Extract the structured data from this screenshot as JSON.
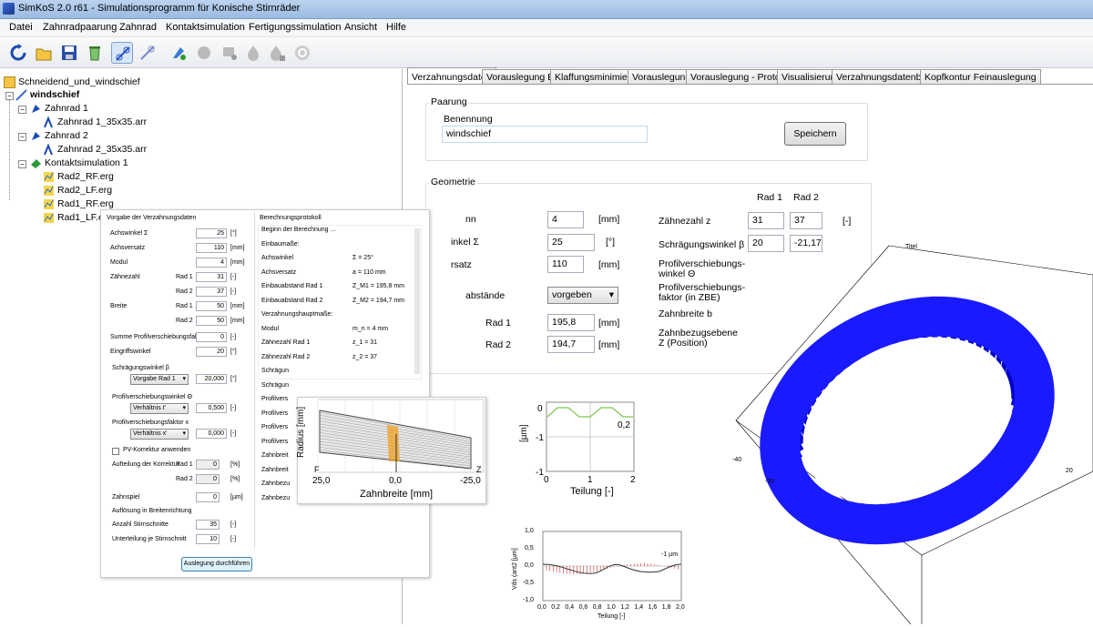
{
  "window": {
    "title": "SimKoS 2.0 r61  - Simulationsprogramm für Konische Stirnräder"
  },
  "menu": [
    "Datei",
    "Zahnradpaarung",
    "Zahnrad",
    "Kontaktsimulation",
    "Fertigungssimulation",
    "Ansicht",
    "Hilfe"
  ],
  "toolbar": {
    "buttons": [
      "refresh-icon",
      "open-folder-icon",
      "save-icon",
      "recycle-bin-icon",
      "new-gear-pair-icon",
      "gear-pair-icon",
      "new-gear-icon",
      "contact-sim-icon",
      "sim-add-icon",
      "fire-icon",
      "fire-add-icon",
      "reset-icon"
    ]
  },
  "tree": {
    "root": "Schneidend_und_windschief",
    "pair": "windschief",
    "gear1": "Zahnrad 1",
    "gear1_file": "Zahnrad 1_35x35.arr",
    "gear2": "Zahnrad 2",
    "gear2_file": "Zahnrad 2_35x35.arr",
    "contact": "Kontaktsimulation 1",
    "results": [
      "Rad2_RF.erg",
      "Rad2_LF.erg",
      "Rad1_RF.erg",
      "Rad1_LF.erg"
    ]
  },
  "tabs": [
    "Verzahnungsdaten",
    "Vorauslegung BM",
    "Klaffungsminimierung",
    "Vorauslegung",
    "Vorauslegung - Protokoll",
    "Visualisierung",
    "Verzahnungsdatenblatt",
    "Kopfkontur Feinauslegung"
  ],
  "paarung": {
    "group": "Paarung",
    "name_label": "Benennung",
    "name_value": "windschief",
    "save_button": "Speichern"
  },
  "geometrie": {
    "group": "Geometrie",
    "col1": "Rad 1",
    "col2": "Rad 2",
    "rows": [
      {
        "label": "nn",
        "value": "4",
        "unit": "[mm]"
      },
      {
        "label": "inkel Σ",
        "value": "25",
        "unit": "[°]"
      },
      {
        "label": "rsatz",
        "value": "110",
        "unit": "[mm]"
      }
    ],
    "abstaende_label": "abstände",
    "abstaende_value": "vorgeben",
    "rad1_label": "Rad 1",
    "rad1_value": "195,8",
    "rad1_unit": "[mm]",
    "rad2_label": "Rad 2",
    "rad2_value": "194,7",
    "rad2_unit": "[mm]",
    "right_labels": [
      "Zähnezahl z",
      "Schrägungswinkel β",
      "Profilverschiebungs-winkel Θ",
      "Profilverschiebungs-faktor (in ZBE)",
      "Zahnbreite b",
      "Zahnbezugsebene Z (Position)"
    ],
    "z1": "31",
    "z2": "37",
    "z_unit": "[-]",
    "beta1": "20",
    "beta2": "-21,172"
  },
  "vorgabe": {
    "title": "Vorgabe der Verzahnungsdaten",
    "rows": [
      {
        "label": "Achswinkel Σ",
        "sub": "",
        "value": "25",
        "unit": "[°]"
      },
      {
        "label": "Achsversatz",
        "sub": "",
        "value": "110",
        "unit": "[mm]"
      },
      {
        "label": "Modul",
        "sub": "",
        "value": "4",
        "unit": "[mm]"
      },
      {
        "label": "Zähnezahl",
        "sub": "Rad 1",
        "value": "31",
        "unit": "[-]"
      },
      {
        "label": "",
        "sub": "Rad 2",
        "value": "37",
        "unit": "[-]"
      },
      {
        "label": "Breite",
        "sub": "Rad 1",
        "value": "50",
        "unit": "[mm]"
      },
      {
        "label": "",
        "sub": "Rad 2",
        "value": "50",
        "unit": "[mm]"
      },
      {
        "label": "Summe Profilverschiebungsfaktor",
        "sub": "",
        "value": "0",
        "unit": "[-]"
      },
      {
        "label": "Eingriffswinkel",
        "sub": "",
        "value": "20",
        "unit": "[°]"
      }
    ],
    "beta_label": "Schrägungswinkel β",
    "beta_select": "Vorgabe Rad 1",
    "beta_value": "20,000",
    "beta_unit": "[°]",
    "theta_label": "Profilverschiebungswinkel Θ",
    "theta_select": "Verhältnis t'",
    "theta_value": "0,500",
    "theta_unit": "[-]",
    "x_label": "Profilverschiebungsfaktor x",
    "x_select": "Verhältnis x'",
    "x_value": "0,000",
    "x_unit": "[-]",
    "pv_label": "PV-Korrektur anwenden",
    "aufteilung_label": "Aufteilung der Korrektur",
    "auf1_sub": "Rad 1",
    "auf1_value": "0",
    "auf1_unit": "[%]",
    "auf2_sub": "Rad 2",
    "auf2_value": "0",
    "auf2_unit": "[%]",
    "spiel_label": "Zahnspiel",
    "spiel_value": "0",
    "spiel_unit": "[µm]",
    "aufloesung_label": "Auflösung in Breitenrichtung",
    "stirn_label": "Anzahl Stirnschnitte",
    "stirn_value": "35",
    "stirn_unit": "[-]",
    "unter_label": "Unterteilung je Stirnschnitt",
    "unter_value": "10",
    "unter_unit": "[-]",
    "run_button": "Auslegung durchführen"
  },
  "protokoll": {
    "title": "Berechnungsprotokoll",
    "lines": [
      {
        "a": "Beginn der Berechnung ...",
        "b": ""
      },
      {
        "a": "Einbaumaße:",
        "b": ""
      },
      {
        "a": "Achswinkel",
        "b": "Σ = 25°"
      },
      {
        "a": "Achsversatz",
        "b": "a = 110 mm"
      },
      {
        "a": "Einbauabstand Rad 1",
        "b": "Z_M1 = 195,8 mm"
      },
      {
        "a": "Einbauabstand Rad 2",
        "b": "Z_M2 = 194,7 mm"
      },
      {
        "a": "Verzahnungshauptmaße:",
        "b": ""
      },
      {
        "a": "Modul",
        "b": "m_n = 4 mm"
      },
      {
        "a": "Zähnezahl Rad 1",
        "b": "z_1 = 31"
      },
      {
        "a": "Zähnezahl Rad 2",
        "b": "z_2 = 37"
      },
      {
        "a": "Schrägun",
        "b": ""
      },
      {
        "a": "Schrägun",
        "b": ""
      },
      {
        "a": "Profilvers",
        "b": ""
      },
      {
        "a": "Profilvers",
        "b": ""
      },
      {
        "a": "Profilvers",
        "b": ""
      },
      {
        "a": "Profilvers",
        "b": ""
      },
      {
        "a": "Zahnbreit",
        "b": ""
      },
      {
        "a": "Zahnbreit",
        "b": ""
      },
      {
        "a": "Zahnbezu",
        "b": ""
      },
      {
        "a": "Zahnbezu",
        "b": ""
      }
    ]
  },
  "flank": {
    "ylabel": "Radius [mm]",
    "xlabel": "Zahnbreite [mm]",
    "xticks": [
      "25,0",
      "0,0",
      "-25,0"
    ],
    "left_label": "F",
    "right_label": "Z"
  },
  "pitch": {
    "ylabel": "[µm]",
    "xlabel": "Teilung [-]",
    "yticks": [
      "0",
      "-1"
    ],
    "xticks": [
      "0",
      "1",
      "2"
    ],
    "ytick_bottom": "-1",
    "annotation": "0,2"
  },
  "tee": {
    "ylabel": "Vds (ant2 [µm]",
    "xlabel": "Teilung [-]",
    "yticks": [
      "1,0",
      "0,5",
      "0,0",
      "-0,5",
      "-1,0"
    ],
    "xticks": [
      "0,0",
      "0,2",
      "0,4",
      "0,6",
      "0,8",
      "1,0",
      "1,2",
      "1,4",
      "1,6",
      "1,8",
      "2,0"
    ],
    "annotation": "-1 µm"
  },
  "gear3d": {
    "title": "Titel",
    "ticks": [
      "-40",
      "-20",
      "20"
    ]
  },
  "colors": {
    "accent": "#1a1aff",
    "orange": "#f0a020",
    "green": "#7ec850",
    "red": "#d03030"
  }
}
